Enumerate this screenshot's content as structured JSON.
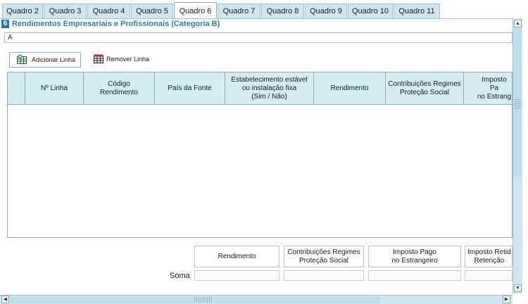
{
  "tabs": [
    "Quadro 2",
    "Quadro 3",
    "Quadro 4",
    "Quadro 5",
    "Quadro 6",
    "Quadro 7",
    "Quadro 8",
    "Quadro 9",
    "Quadro 10",
    "Quadro 11"
  ],
  "active_tab": "Quadro 6",
  "section": {
    "number": "6",
    "title": "Rendimentos Empresariais e Profissionais (Categoria B)"
  },
  "field_a": {
    "label": "A",
    "value": ""
  },
  "toolbar": {
    "add_label": "Adicionar Linha",
    "remove_label": "Remover Linha"
  },
  "grid": {
    "columns": [
      "Nº Linha",
      "Código\nRendimento",
      "País da Fonte",
      "Estabelecimento estável\nou instalação fixa\n(Sim / Não)",
      "Rendimento",
      "Contribuições Regimes\nProteção Social",
      "Imposto Pa\nno Estrang"
    ],
    "rows": []
  },
  "totals": {
    "label": "Soma",
    "columns": [
      "Rendimento",
      "Contribuições Regimes\nProteção Social",
      "Imposto Pago\nno Estrangeiro",
      "Imposto Retid\nRetenção"
    ],
    "values": [
      "",
      "",
      "",
      ""
    ]
  },
  "icons": {
    "add": "add-row-icon",
    "remove": "remove-row-icon"
  },
  "colors": {
    "tab_bg": "#cfe6f0",
    "header_bg": "#d3edf2",
    "section_title": "#2a7fa8",
    "section_badge": "#1d7bb0"
  }
}
